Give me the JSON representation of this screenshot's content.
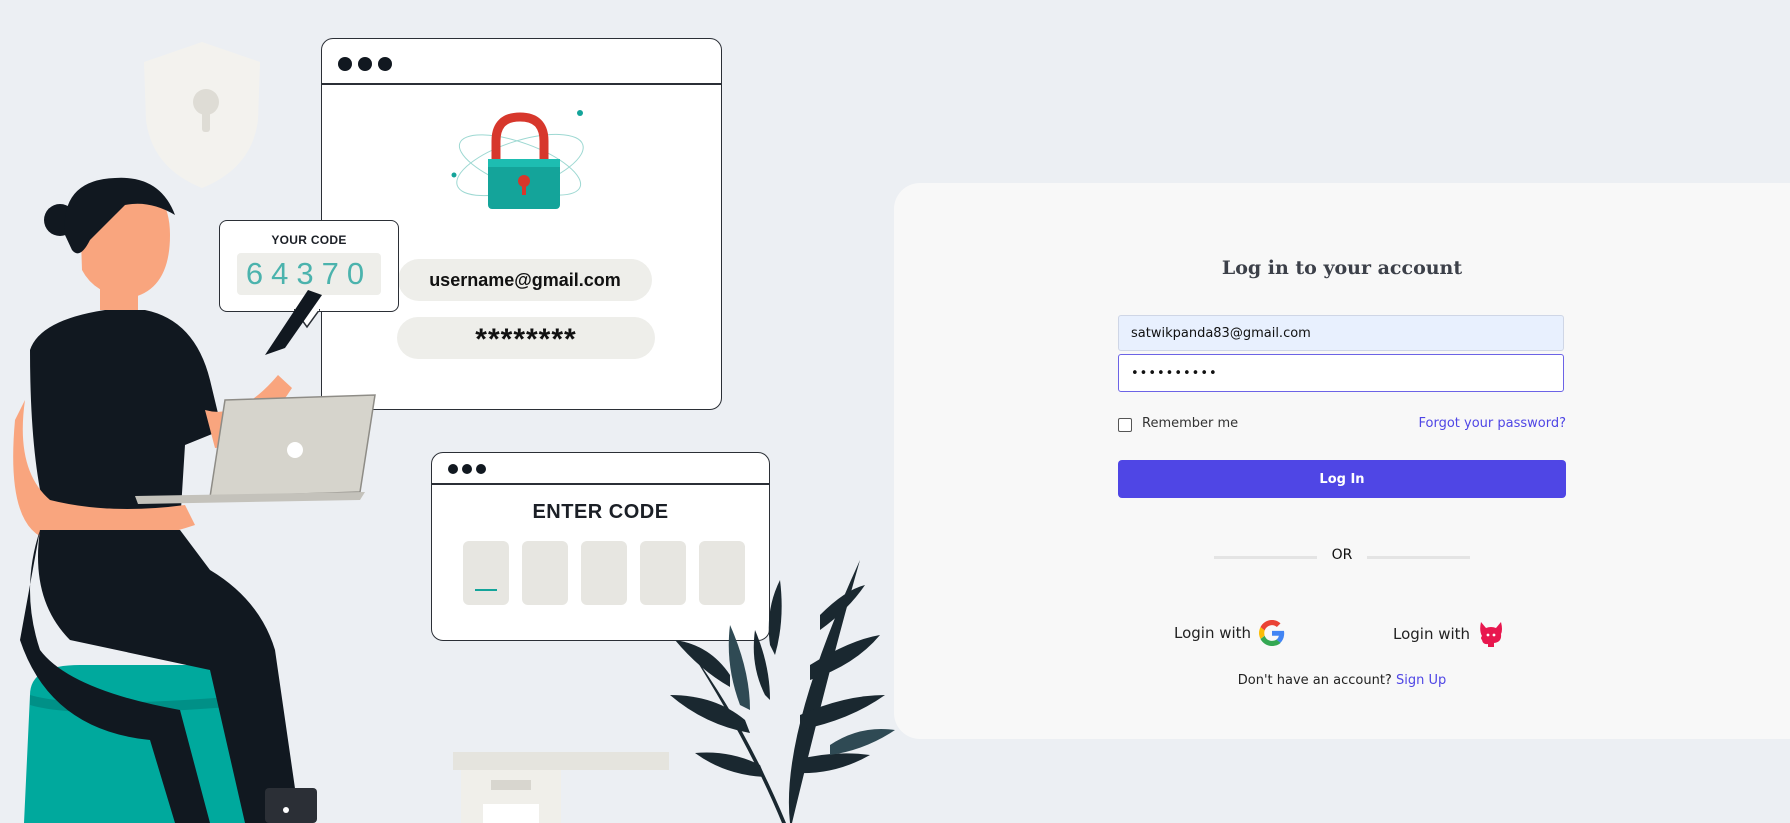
{
  "illustration": {
    "code_label": "YOUR CODE",
    "code_value": "64370",
    "username_pill": "username@gmail.com",
    "password_pill": "********",
    "enter_code_title": "ENTER CODE"
  },
  "login": {
    "title": "Log in to your account",
    "email_value": "satwikpanda83@gmail.com",
    "password_value": "••••••••••",
    "remember_label": "Remember me",
    "forgot_label": "Forgot your password?",
    "login_button": "Log In",
    "or_label": "OR",
    "google_label": "Login with",
    "github_label": "Login with",
    "signup_prompt": "Don't have an account?",
    "signup_link": "Sign Up"
  },
  "colors": {
    "accent": "#4f46e5",
    "background": "#eceff3",
    "card": "#f8f8f8",
    "teal": "#00a99d"
  }
}
